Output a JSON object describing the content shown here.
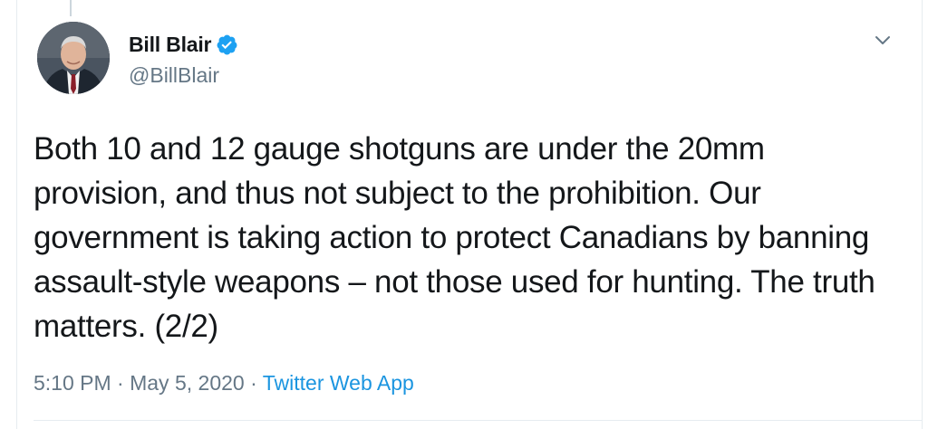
{
  "tweet": {
    "author": {
      "display_name": "Bill Blair",
      "handle": "@BillBlair",
      "verified": true
    },
    "text": "Both 10 and 12 gauge shotguns are under the 20mm provision, and thus not subject to the prohibition. Our government is taking action to protect Canadians by banning assault-style weapons – not those used for hunting. The truth matters. (2/2)",
    "time": "5:10 PM",
    "separator_1": "·",
    "date": "May 5, 2020",
    "separator_2": "·",
    "source": "Twitter Web App"
  },
  "colors": {
    "text_primary": "#14171a",
    "text_secondary": "#657786",
    "link": "#1b95e0",
    "verified": "#1da1f2",
    "border": "#e6ecf0"
  },
  "icons": {
    "verified": "verified-badge-icon",
    "menu": "chevron-down-icon"
  }
}
